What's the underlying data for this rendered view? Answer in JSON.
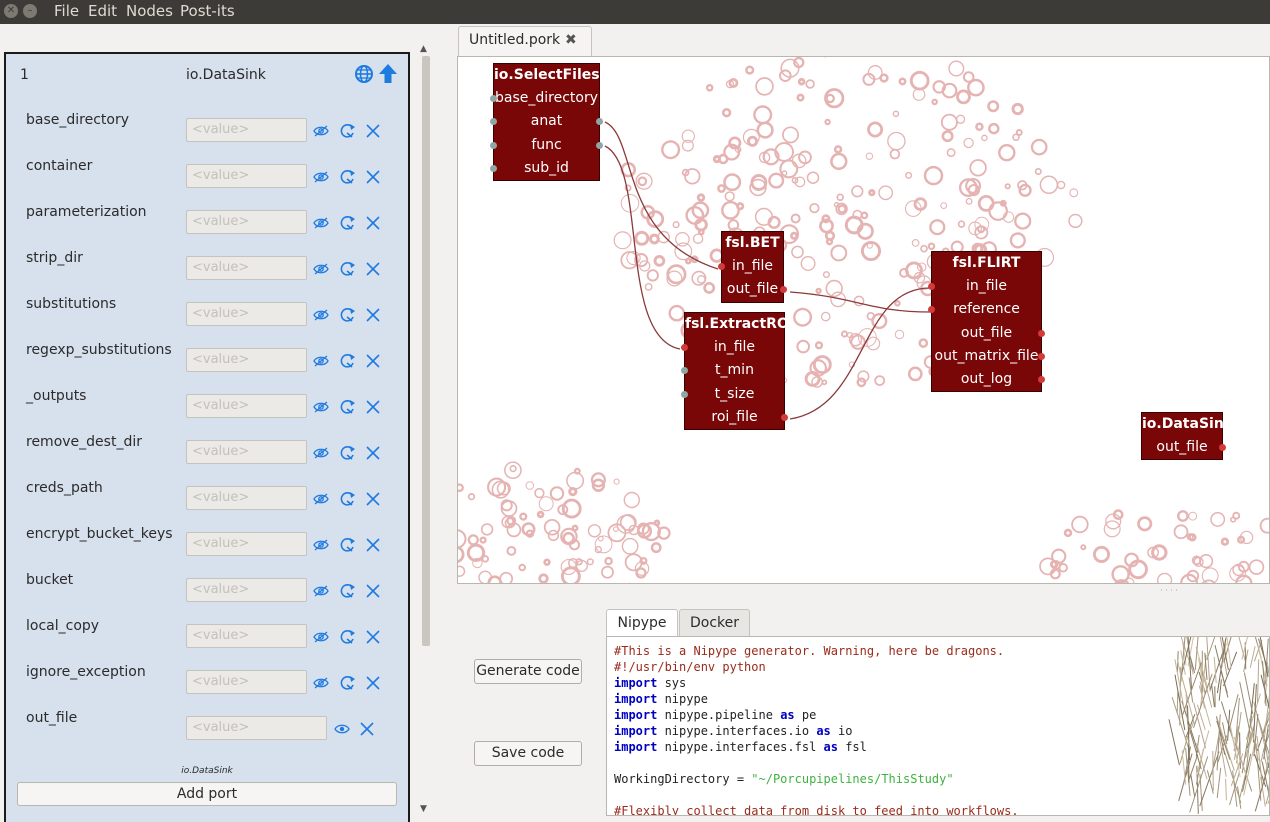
{
  "menu": {
    "items": [
      "File",
      "Edit",
      "Nodes",
      "Post-its"
    ]
  },
  "node_editor": {
    "index": "1",
    "title": "io.DataSink",
    "input_placeholder": "<value>",
    "params": [
      "base_directory",
      "container",
      "parameterization",
      "strip_dir",
      "substitutions",
      "regexp_substitutions",
      "_outputs",
      "remove_dest_dir",
      "creds_path",
      "encrypt_bucket_keys",
      "bucket",
      "local_copy",
      "ignore_exception",
      "out_file"
    ],
    "footer": "io.DataSink",
    "add_port": "Add port"
  },
  "file_tab": {
    "label": "Untitled.pork"
  },
  "canvas": {
    "nodes": [
      {
        "title": "io.SelectFiles",
        "ports": [
          "base_directory",
          "anat",
          "func",
          "sub_id"
        ]
      },
      {
        "title": "fsl.BET",
        "ports": [
          "in_file",
          "out_file"
        ]
      },
      {
        "title": "fsl.ExtractROI",
        "ports": [
          "in_file",
          "t_min",
          "t_size",
          "roi_file"
        ]
      },
      {
        "title": "fsl.FLIRT",
        "ports": [
          "in_file",
          "reference",
          "out_file",
          "out_matrix_file",
          "out_log"
        ]
      },
      {
        "title": "io.DataSink",
        "ports": [
          "out_file"
        ]
      }
    ]
  },
  "buttons": {
    "generate": "Generate code",
    "save": "Save code"
  },
  "code_tabs": [
    "Nipype",
    "Docker"
  ],
  "code_lines": [
    "#This is a Nipype generator. Warning, here be dragons.",
    "#!/usr/bin/env python",
    "import sys",
    "import nipype",
    "import nipype.pipeline as pe",
    "import nipype.interfaces.io as io",
    "import nipype.interfaces.fsl as fsl",
    "",
    "WorkingDirectory = \"~/Porcupipelines/ThisStudy\"",
    "",
    "#Flexibly collect data from disk to feed into workflows."
  ],
  "colors": {
    "node_fill": "#7a0707",
    "panel_bg": "#d7e0ed",
    "icon_blue": "#1e7be0",
    "menubar": "#3c3b37"
  }
}
